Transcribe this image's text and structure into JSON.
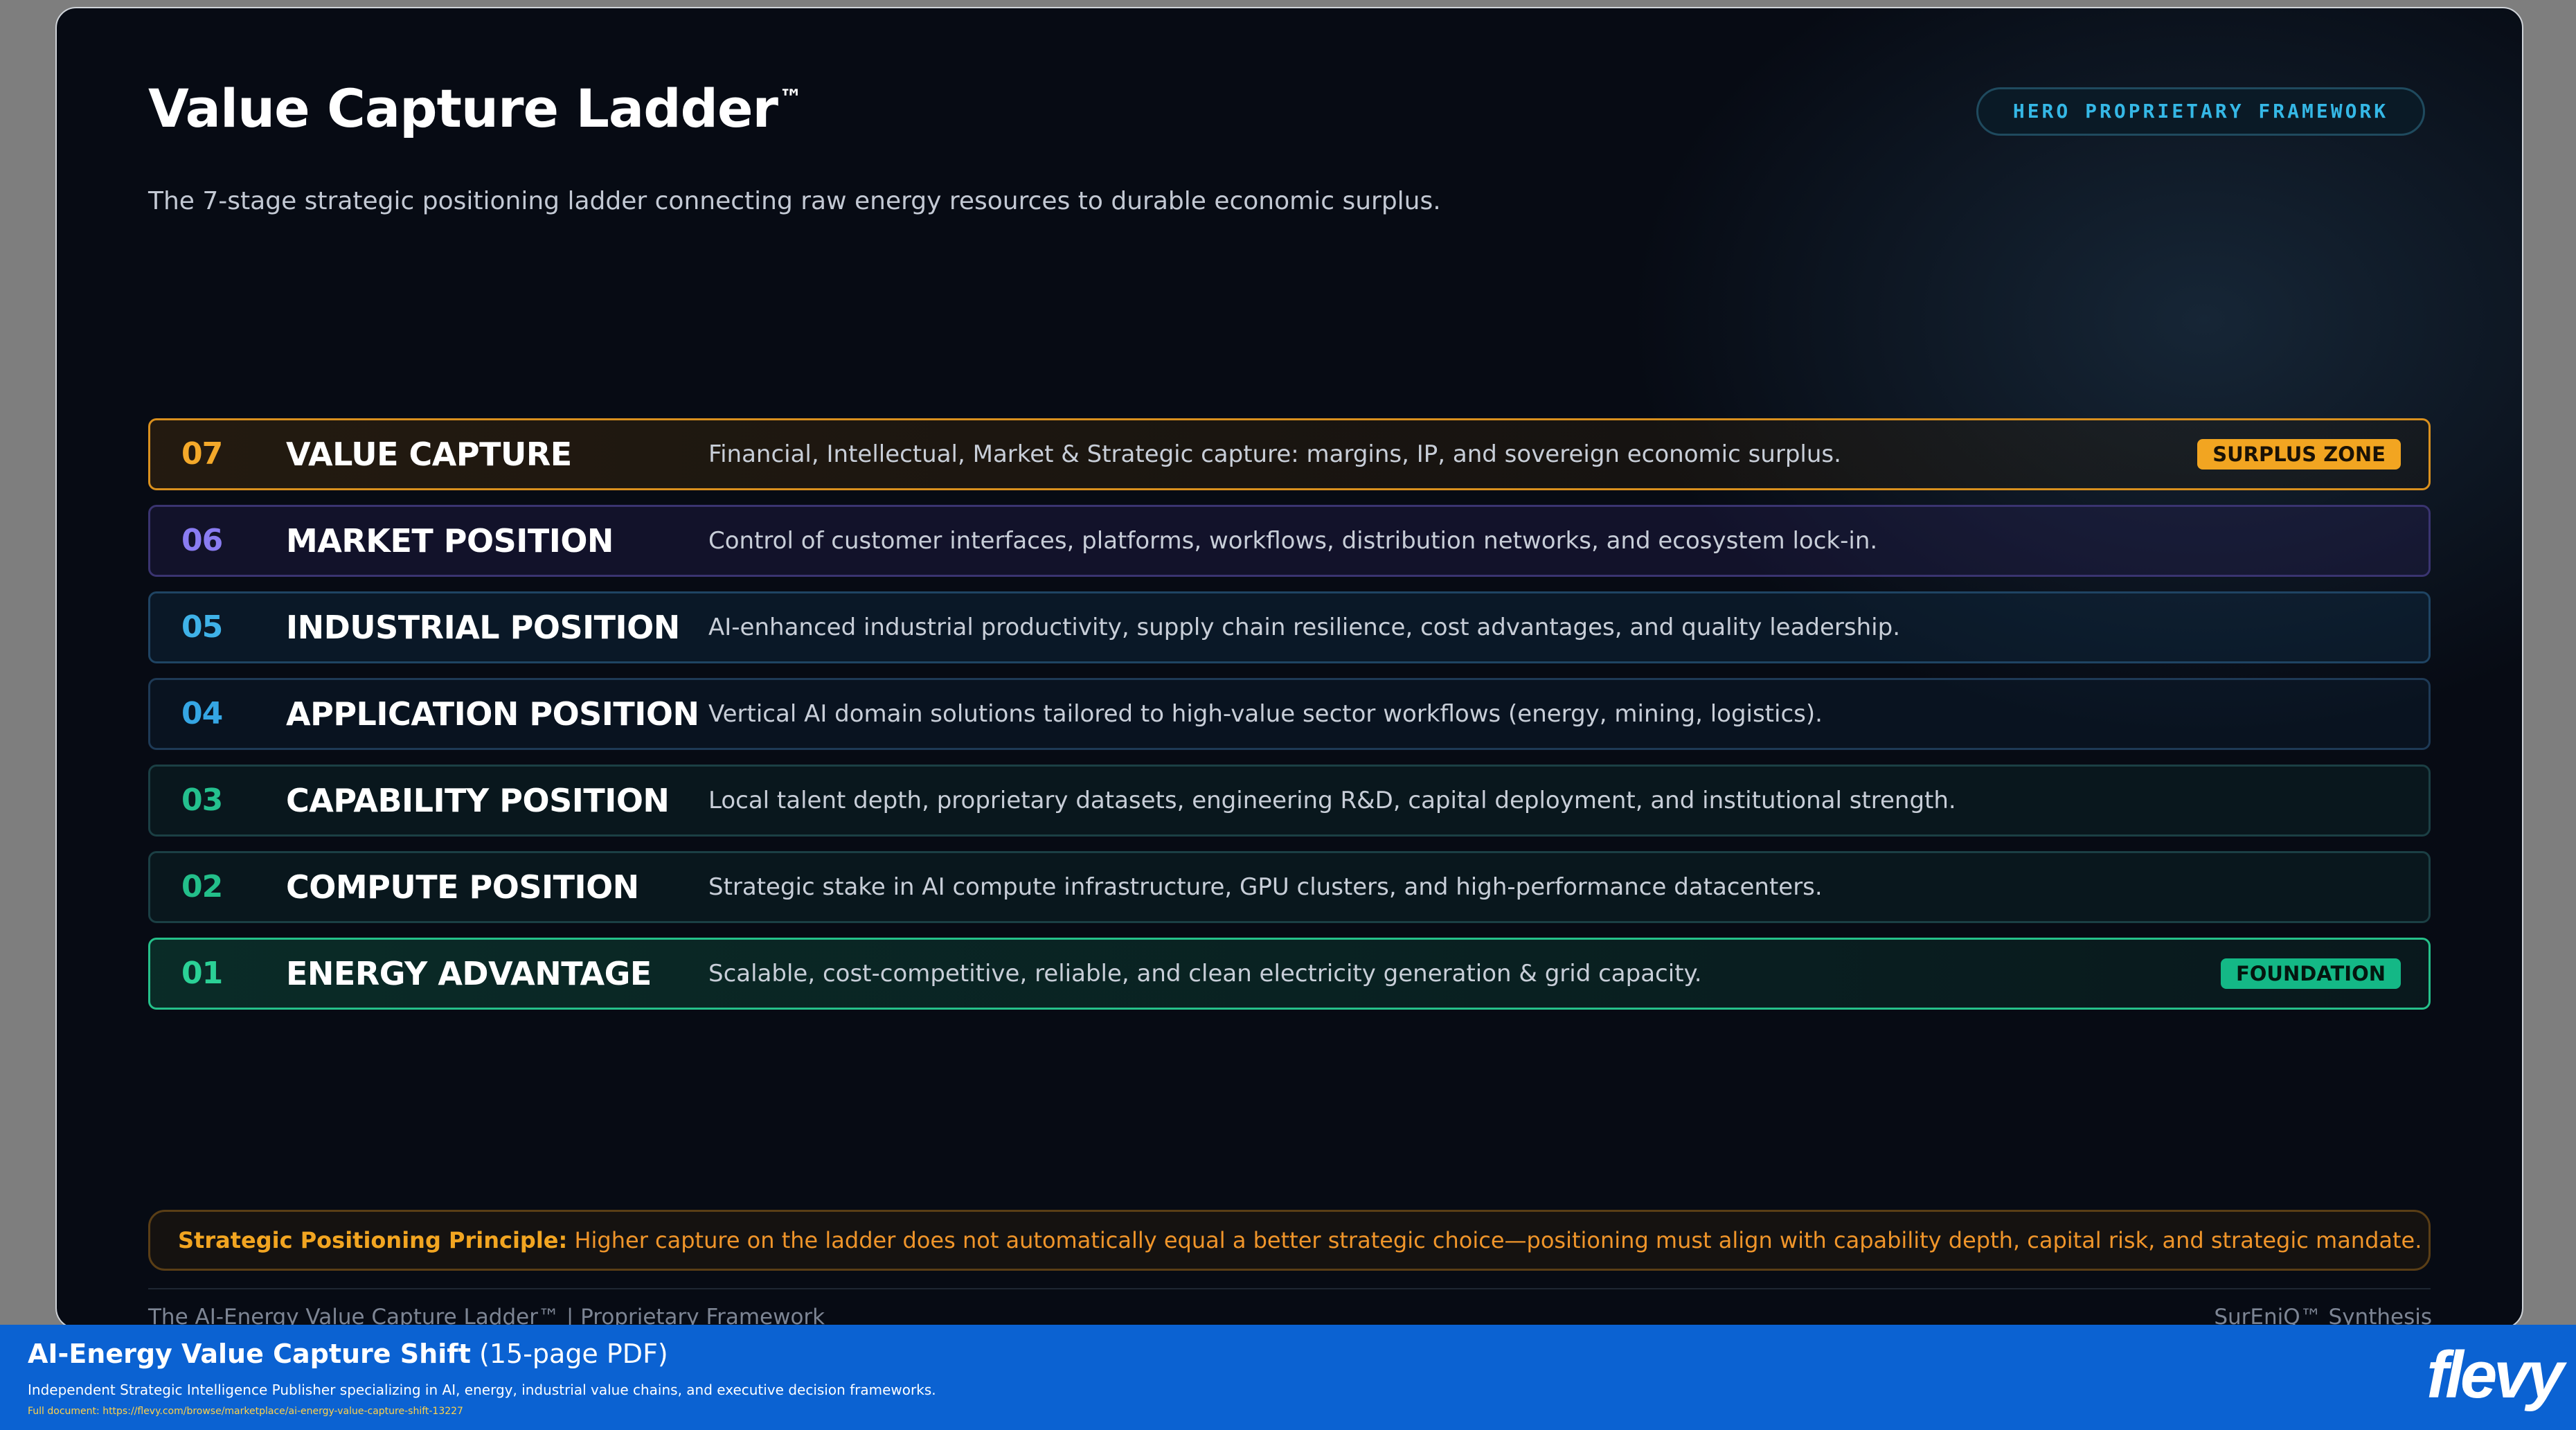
{
  "slide": {
    "title": "Value Capture Ladder",
    "title_mark": "™",
    "subtitle": "The 7-stage strategic positioning ladder connecting raw energy resources to durable economic surplus.",
    "badge": "HERO PROPRIETARY FRAMEWORK"
  },
  "ladder": [
    {
      "num": "07",
      "name": "VALUE CAPTURE",
      "desc": "Financial, Intellectual, Market & Strategic capture: margins, IP, and sovereign economic surplus.",
      "tag": "SURPLUS ZONE",
      "accent": "#f4a92a"
    },
    {
      "num": "06",
      "name": "MARKET POSITION",
      "desc": "Control of customer interfaces, platforms, workflows, distribution networks, and ecosystem lock-in.",
      "tag": "",
      "accent": "#8a7cf2"
    },
    {
      "num": "05",
      "name": "INDUSTRIAL POSITION",
      "desc": "AI-enhanced industrial productivity, supply chain resilience, cost advantages, and quality leadership.",
      "tag": "",
      "accent": "#3fb2e8"
    },
    {
      "num": "04",
      "name": "APPLICATION POSITION",
      "desc": "Vertical AI domain solutions tailored to high-value sector workflows (energy, mining, logistics).",
      "tag": "",
      "accent": "#35a6e4"
    },
    {
      "num": "03",
      "name": "CAPABILITY POSITION",
      "desc": "Local talent depth, proprietary datasets, engineering R&D, capital deployment, and institutional strength.",
      "tag": "",
      "accent": "#24c08e"
    },
    {
      "num": "02",
      "name": "COMPUTE POSITION",
      "desc": "Strategic stake in AI compute infrastructure, GPU clusters, and high-performance datacenters.",
      "tag": "",
      "accent": "#23bf8a"
    },
    {
      "num": "01",
      "name": "ENERGY ADVANTAGE",
      "desc": "Scalable, cost-competitive, reliable, and clean electricity generation & grid capacity.",
      "tag": "FOUNDATION",
      "accent": "#2bd196"
    }
  ],
  "principle": {
    "lead": "Strategic Positioning Principle:",
    "body": " Higher capture on the ladder does not automatically equal a better strategic choice—positioning must align with capability depth, capital risk, and strategic mandate."
  },
  "footer": {
    "left": "The AI-Energy Value Capture Ladder™ | Proprietary Framework",
    "right": "SurEniQ™ Synthesis"
  },
  "banner": {
    "title": "AI-Energy Value Capture Shift",
    "pages": " (15-page PDF)",
    "description": "Independent Strategic Intelligence Publisher specializing in AI, energy, industrial value chains, and executive decision frameworks.",
    "link": "Full document: https://flevy.com/browse/marketplace/ai-energy-value-capture-shift-13227",
    "logo": "flevy"
  },
  "colors": {
    "background": "#070b14",
    "surplus": "#f2a521",
    "foundation": "#14b886",
    "banner": "#0b62d2"
  }
}
